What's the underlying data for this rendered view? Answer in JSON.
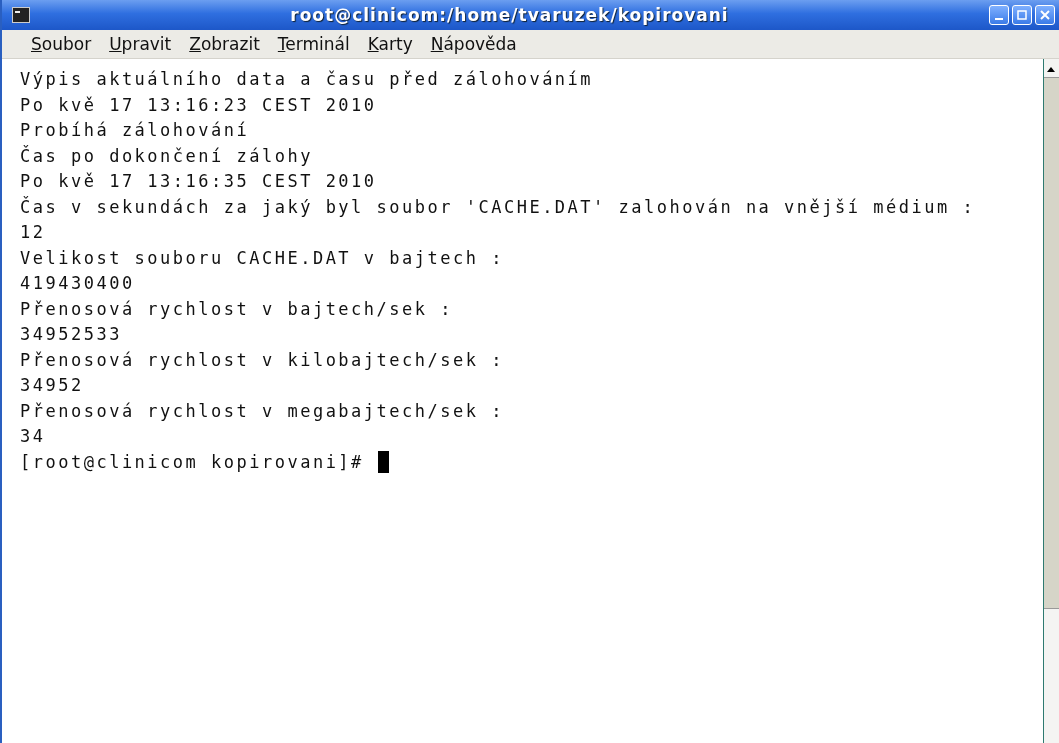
{
  "window": {
    "title": "root@clinicom:/home/tvaruzek/kopirovani"
  },
  "menu": [
    "Soubor",
    "Upravit",
    "Zobrazit",
    "Terminál",
    "Karty",
    "Nápověda"
  ],
  "terminal": {
    "lines": [
      "Výpis aktuálního data a času před zálohováním",
      "Po kvě 17 13:16:23 CEST 2010",
      "Probíhá zálohování",
      "Čas po dokončení zálohy",
      "Po kvě 17 13:16:35 CEST 2010",
      "Čas v sekundách za jaký byl soubor 'CACHE.DAT' zalohován na vnější médium :",
      "12",
      "Velikost souboru CACHE.DAT v bajtech :",
      "419430400",
      "Přenosová rychlost v bajtech/sek :",
      "34952533",
      "Přenosová rychlost v kilobajtech/sek :",
      "34952",
      "Přenosová rychlost v megabajtech/sek :",
      "34"
    ],
    "prompt": "[root@clinicom kopirovani]#"
  }
}
